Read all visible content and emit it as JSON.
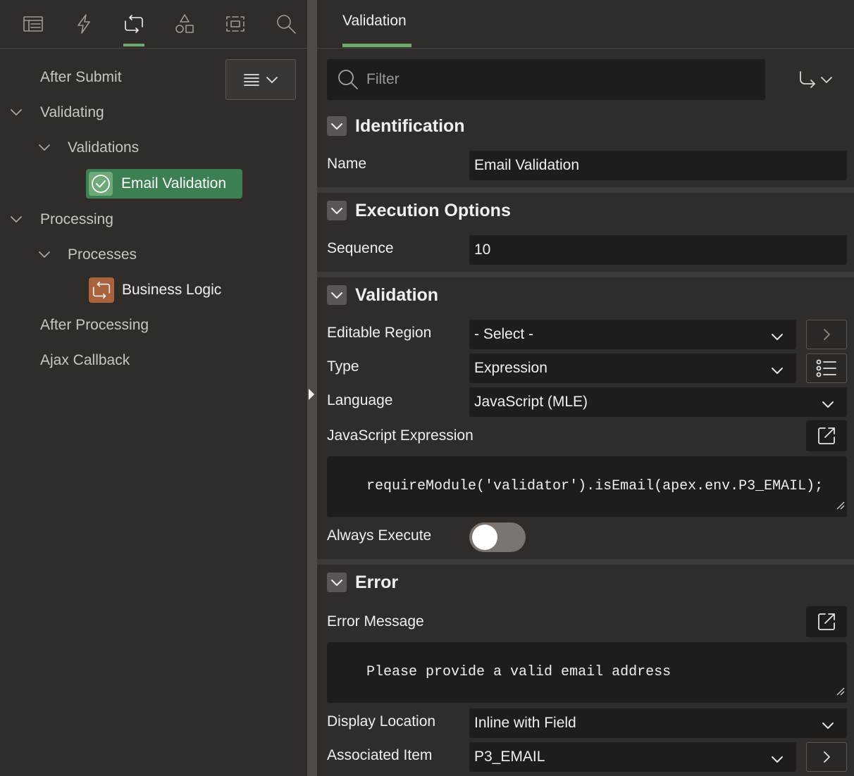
{
  "left_tabs": [
    {
      "name": "rendering",
      "icon": "page-layout-icon"
    },
    {
      "name": "dynamic-actions",
      "icon": "lightning-icon"
    },
    {
      "name": "processing",
      "icon": "processing-cycle-icon",
      "active": true
    },
    {
      "name": "shared-components",
      "icon": "shapes-icon"
    },
    {
      "name": "page-shared",
      "icon": "region-frame-icon"
    },
    {
      "name": "search",
      "icon": "search-icon"
    }
  ],
  "tree": {
    "after_submit": "After Submit",
    "validating": "Validating",
    "validations": "Validations",
    "email_validation": "Email Validation",
    "processing": "Processing",
    "processes": "Processes",
    "business_logic": "Business Logic",
    "after_processing": "After Processing",
    "ajax_callback": "Ajax Callback"
  },
  "right": {
    "tab_label": "Validation",
    "filter_placeholder": "Filter",
    "sections": {
      "identification": "Identification",
      "execution_options": "Execution Options",
      "validation": "Validation",
      "error": "Error"
    },
    "labels": {
      "name": "Name",
      "sequence": "Sequence",
      "editable_region": "Editable Region",
      "type": "Type",
      "language": "Language",
      "js_expression": "JavaScript Expression",
      "always_execute": "Always Execute",
      "error_message": "Error Message",
      "display_location": "Display Location",
      "associated_item": "Associated Item"
    },
    "values": {
      "name": "Email Validation",
      "sequence": "10",
      "editable_region": "- Select -",
      "type": "Expression",
      "language": "JavaScript (MLE)",
      "js_expression": "requireModule('validator').isEmail(apex.env.P3_EMAIL);",
      "always_execute": false,
      "error_message": "Please provide a valid email address",
      "display_location": "Inline with Field",
      "associated_item": "P3_EMAIL"
    }
  },
  "colors": {
    "accent_green": "#6ea86a",
    "selected_node": "#3b7f52",
    "process_icon": "#a8633c"
  }
}
